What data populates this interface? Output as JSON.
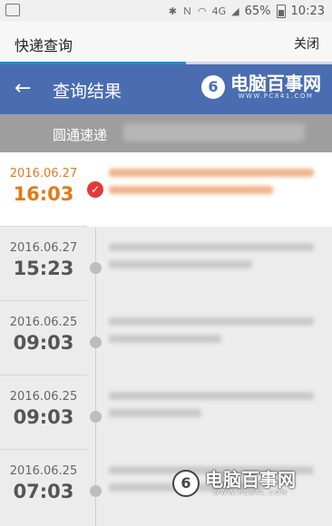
{
  "status_bar": {
    "icons": [
      "image-icon",
      "bluetooth-icon",
      "nfc-icon",
      "wifi-icon",
      "4g-icon",
      "signal-icon",
      "battery-icon"
    ],
    "network_label": "4G",
    "battery": "65%",
    "time": "10:23"
  },
  "web_bar": {
    "title": "快递查询",
    "close_label": "关闭",
    "progress": 0.56
  },
  "app_bar": {
    "back_icon": "arrow-left-icon",
    "title": "查询结果",
    "watermark": {
      "name": "电脑百事网",
      "site": "WWW.PC841.COM"
    }
  },
  "courier": {
    "company": "圆通速递"
  },
  "timeline": [
    {
      "date": "2016.06.27",
      "time": "16:03",
      "active": true
    },
    {
      "date": "2016.06.27",
      "time": "15:23",
      "active": false
    },
    {
      "date": "2016.06.25",
      "time": "09:03",
      "active": false
    },
    {
      "date": "2016.06.25",
      "time": "09:03",
      "active": false
    },
    {
      "date": "2016.06.25",
      "time": "07:03",
      "active": false
    }
  ],
  "bottom_watermark": {
    "name": "电脑百事网",
    "site": "WWW.PC841.COM"
  },
  "colors": {
    "app_bar": "#4a6db1",
    "accent": "#e07a18",
    "check": "#e23a3a",
    "progress": "#1e8fd6"
  }
}
